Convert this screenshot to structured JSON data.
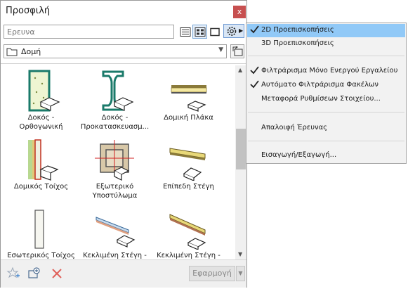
{
  "window": {
    "title": "Προσφιλή",
    "close_label": "x"
  },
  "search": {
    "placeholder": "Ερευνα",
    "value": ""
  },
  "view_buttons": [
    {
      "name": "list-view-icon",
      "active": false
    },
    {
      "name": "grid-view-icon",
      "active": true
    },
    {
      "name": "preview-view-icon",
      "active": false
    }
  ],
  "folder": {
    "selected": "Δομή",
    "icon": "folder-icon"
  },
  "items": [
    {
      "label": "Δοκός -\nΟρθογωνική",
      "icon": "rectangular-beam-icon"
    },
    {
      "label": "Δοκός -\nΠροκατασκευασμ...",
      "icon": "i-beam-icon"
    },
    {
      "label": "Δομική Πλάκα",
      "icon": "structural-slab-icon"
    },
    {
      "label": "Δομικός Τοίχος",
      "icon": "structural-wall-icon"
    },
    {
      "label": "Εξωτερικό\nΥποστύλωμα",
      "icon": "column-icon"
    },
    {
      "label": "Επίπεδη Στέγη",
      "icon": "flat-roof-icon"
    },
    {
      "label": "Εσωτερικός Τοίχος\nΓυψοσανίδας",
      "icon": "interior-wall-icon"
    },
    {
      "label": "Κεκλιμένη Στέγη -\nΜεταλλική",
      "icon": "sloped-roof-metal-icon"
    },
    {
      "label": "Κεκλιμένη Στέγη -\nΠλακίδια",
      "icon": "sloped-roof-tile-icon"
    }
  ],
  "bottom": {
    "apply_label": "Εφαρμογή"
  },
  "menu": {
    "items": [
      {
        "label": "2D Προεπισκοπήσεις",
        "checked": true,
        "highlighted": true
      },
      {
        "label": "3D Προεπισκοπήσεις",
        "checked": false,
        "highlighted": false
      },
      {
        "separator": true
      },
      {
        "label": "Φιλτράρισμα Μόνο Ενεργού Εργαλείου",
        "checked": true,
        "highlighted": false
      },
      {
        "label": "Αυτόματο Φιλτράρισμα Φακέλων",
        "checked": true,
        "highlighted": false
      },
      {
        "label": "Μεταφορά Ρυθμίσεων Στοιχείου...",
        "checked": false,
        "highlighted": false
      },
      {
        "separator": true
      },
      {
        "label": "Απαλοιφή Έρευνας",
        "checked": false,
        "highlighted": false
      },
      {
        "separator": true
      },
      {
        "label": "Εισαγωγή/Εξαγωγή...",
        "checked": false,
        "highlighted": false
      }
    ]
  },
  "colors": {
    "accent": "#91c9f7",
    "close": "#c75050",
    "delete": "#e0605a"
  }
}
